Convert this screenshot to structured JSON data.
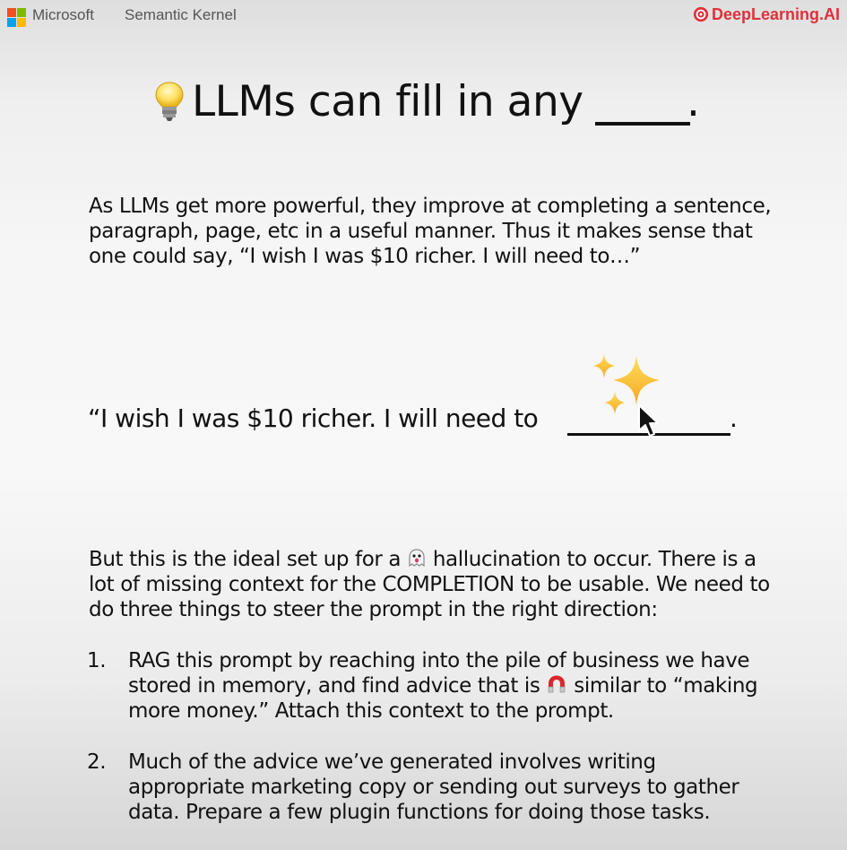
{
  "header": {
    "brand_left": "Microsoft",
    "product": "Semantic Kernel",
    "brand_right": "DeepLearning.AI",
    "ms_logo_colors": [
      "#f25022",
      "#7fba00",
      "#00a4ef",
      "#ffb900"
    ],
    "dl_color": "#e0303a"
  },
  "slide": {
    "title_icon": "lightbulb-icon",
    "title": "LLMs can fill in any",
    "title_end": ".",
    "intro_lines": [
      "As LLMs get more powerful, they improve at completing a sentence,",
      "paragraph, page, etc in a useful manner. Thus it makes sense that",
      "one could say, “I wish I was $10 richer. I will need to…”"
    ],
    "quote": "“I wish I was $10 richer. I will need to",
    "quote_end": ".",
    "quote_icon": "sparkles-icon",
    "cursor_icon": "mouse-pointer-icon",
    "body_line1_pre": "But this is the ideal set up for a",
    "body_icon": "ghost-icon",
    "body_line1_post": "hallucination to occur. There is a",
    "body_lines": [
      "lot of missing context for the COMPLETION to be usable. We need to",
      "do three things to steer the prompt in the right direction:"
    ],
    "items": [
      {
        "number": "1.",
        "line1": "RAG this prompt by reaching into the pile of business we have",
        "line2_pre": "stored in memory, and find advice that is",
        "line2_icon": "magnet-icon",
        "line2_post": "similar to “making",
        "line3": "more money.” Attach this context to the prompt."
      },
      {
        "number": "2.",
        "line1": "Much of the advice we’ve generated involves writing",
        "line2": "appropriate marketing copy or sending out surveys to gather",
        "line3": "data. Prepare a few plugin functions for doing those tasks."
      }
    ]
  }
}
